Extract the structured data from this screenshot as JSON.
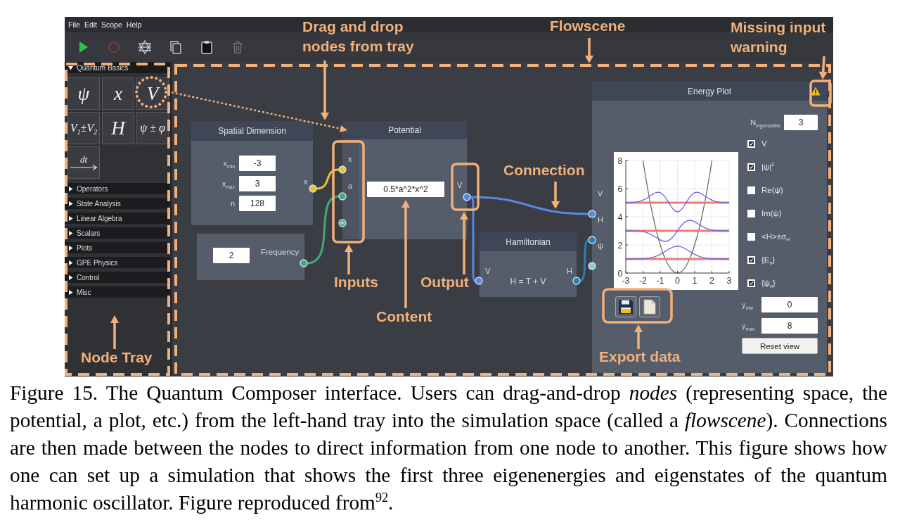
{
  "menu": [
    {
      "label": "File"
    },
    {
      "label": "Edit"
    },
    {
      "label": "Scope"
    },
    {
      "label": "Help"
    }
  ],
  "toolbar": [
    {
      "kind": "run",
      "disabled": false
    },
    {
      "kind": "record",
      "disabled": true
    },
    {
      "kind": "graph",
      "disabled": false
    },
    {
      "kind": "copy",
      "disabled": false
    },
    {
      "kind": "paste",
      "disabled": false
    },
    {
      "kind": "delete",
      "disabled": true
    }
  ],
  "tray": {
    "categories": [
      {
        "label": "Quantum Basics",
        "expanded": true,
        "tiles": [
          {
            "kind": "symbol",
            "symbol": "ψ"
          },
          {
            "kind": "symbol",
            "symbol": "x"
          },
          {
            "kind": "symbol",
            "symbol": "V"
          },
          {
            "kind": "expression",
            "symbol": "V$_{1}$±V$_{2}$"
          },
          {
            "kind": "symbol",
            "symbol": "H"
          },
          {
            "kind": "expression",
            "symbol": "ψ ± φ"
          },
          {
            "kind": "arrow",
            "symbol": "dt"
          }
        ]
      },
      {
        "label": "Operators",
        "expanded": false
      },
      {
        "label": "State Analysis",
        "expanded": false
      },
      {
        "label": "Linear Algebra",
        "expanded": false
      },
      {
        "label": "Scalars",
        "expanded": false
      },
      {
        "label": "Plots",
        "expanded": false
      },
      {
        "label": "GPE Physics",
        "expanded": false
      },
      {
        "label": "Control",
        "expanded": false
      },
      {
        "label": "Misc",
        "expanded": false
      }
    ]
  },
  "flowscene": {
    "spatial_dimension": {
      "title": "Spatial Dimension",
      "fields": [
        {
          "label": "x$_{min}$",
          "value": "-3"
        },
        {
          "label": "x$_{max}$",
          "value": "3"
        },
        {
          "label": "n",
          "value": "128"
        }
      ],
      "output": "x"
    },
    "frequency": {
      "value": "2",
      "label": "Frequency"
    },
    "potential": {
      "title": "Potential",
      "inputs": [
        "x",
        "a"
      ],
      "content": "0.5*a^2*x^2",
      "output": "V"
    },
    "hamiltonian": {
      "title": "Hamiltonian",
      "input": "V",
      "content": "H = T + V",
      "output": "H"
    },
    "energy_plot": {
      "title": "Energy Plot",
      "warning": true,
      "inputs": [
        "V",
        "H",
        "ψ"
      ],
      "n_eigenstates": {
        "label": "N$_{eigenstates}$",
        "value": "3"
      },
      "options": [
        {
          "label": "V",
          "checked": true
        },
        {
          "label": "|ψ|$^{2}$",
          "checked": true
        },
        {
          "label": "Re(ψ)",
          "checked": false
        },
        {
          "label": "Im(ψ)",
          "checked": false
        },
        {
          "label": "<H>±σ$_{H}$",
          "checked": false
        },
        {
          "label": "{E$_{n}$}",
          "checked": true
        },
        {
          "label": "{ψ$_{n}$}",
          "checked": true
        }
      ],
      "y_min": {
        "label": "y$_{min}$",
        "value": "0"
      },
      "y_max": {
        "label": "y$_{max}$",
        "value": "8"
      },
      "reset_button": "Reset view",
      "chart_data": {
        "type": "line",
        "grid": true,
        "x": [
          -3,
          -2.75,
          -2.5,
          -2.25,
          -2,
          -1.75,
          -1.5,
          -1.25,
          -1,
          -0.75,
          -0.5,
          -0.25,
          0,
          0.25,
          0.5,
          0.75,
          1,
          1.25,
          1.5,
          1.75,
          2,
          2.25,
          2.5,
          2.75,
          3
        ],
        "xlim": [
          -3,
          3
        ],
        "ylim": [
          0,
          8
        ],
        "xticks": [
          -3,
          -2,
          -1,
          0,
          1,
          2,
          3
        ],
        "yticks": [
          0,
          2,
          4,
          6,
          8
        ],
        "series": [
          {
            "color": "#6e6e6e",
            "values": [
              null,
              null,
              null,
              null,
              8,
              6.13,
              4.5,
              3.13,
              2,
              1.13,
              0.5,
              0.13,
              0,
              0.13,
              0.5,
              1.13,
              2,
              3.13,
              4.5,
              6.13,
              8,
              null,
              null,
              null,
              null
            ]
          },
          {
            "color": "#ef7b76",
            "values": [
              1,
              1,
              1,
              1,
              1,
              1,
              1,
              1,
              1,
              1,
              1,
              1,
              1,
              1,
              1,
              1,
              1,
              1,
              1,
              1,
              1,
              1,
              1,
              1,
              1
            ]
          },
          {
            "color": "#ef7b76",
            "values": [
              3,
              3,
              3,
              3,
              3,
              3,
              3,
              3,
              3,
              3,
              3,
              3,
              3,
              3,
              3,
              3,
              3,
              3,
              3,
              3,
              3,
              3,
              3,
              3,
              3
            ]
          },
          {
            "color": "#ef7b76",
            "values": [
              5,
              5,
              5,
              5,
              5,
              5,
              5,
              5,
              5,
              5,
              5,
              5,
              5,
              5,
              5,
              5,
              5,
              5,
              5,
              5,
              5,
              5,
              5,
              5,
              5
            ]
          },
          {
            "color": "#6f63e0",
            "values": [
              1,
              1,
              1,
              1.01,
              1.02,
              1.04,
              1.09,
              1.19,
              1.33,
              1.51,
              1.7,
              1.85,
              1.9,
              1.85,
              1.7,
              1.51,
              1.33,
              1.19,
              1.09,
              1.04,
              1.02,
              1.01,
              1,
              1,
              1
            ]
          },
          {
            "color": "#6f63e0",
            "values": [
              3,
              3,
              2.99,
              2.98,
              2.94,
              2.86,
              2.72,
              2.54,
              2.36,
              2.25,
              2.32,
              2.59,
              3,
              3.41,
              3.68,
              3.75,
              3.64,
              3.46,
              3.28,
              3.14,
              3.06,
              3.02,
              3.01,
              3,
              3
            ]
          },
          {
            "color": "#6f63e0",
            "values": [
              5,
              5.01,
              5.03,
              5.08,
              5.18,
              5.34,
              5.55,
              5.72,
              5.72,
              5.46,
              5,
              4.54,
              4.35,
              4.54,
              5,
              5.46,
              5.72,
              5.72,
              5.55,
              5.34,
              5.18,
              5.08,
              5.03,
              5.01,
              5
            ]
          }
        ]
      }
    }
  },
  "annotations": [
    {
      "kind": "drag_drop",
      "text": "Drag and drop nodes from tray"
    },
    {
      "kind": "flowscene",
      "text": "Flowscene"
    },
    {
      "kind": "missing_input",
      "text": "Missing input warning"
    },
    {
      "kind": "connection",
      "text": "Connection"
    },
    {
      "kind": "inputs",
      "text": "Inputs"
    },
    {
      "kind": "output",
      "text": "Output"
    },
    {
      "kind": "content",
      "text": "Content"
    },
    {
      "kind": "export",
      "text": "Export data"
    },
    {
      "kind": "node_tray",
      "text": "Node Tray"
    }
  ],
  "caption": "Figure 15. The Quantum Composer interface. Users can drag-and-drop *nodes* (representing space, the potential, a plot, etc.) from the left-hand tray into the simulation space (called a *flowscene*). Connections are then made between the nodes to direct information from one node to another. This figure shows how one can set up a simulation that shows the first three eigenenergies and eigenstates of the quantum harmonic oscillator. Figure reproduced from$^{92}$."
}
